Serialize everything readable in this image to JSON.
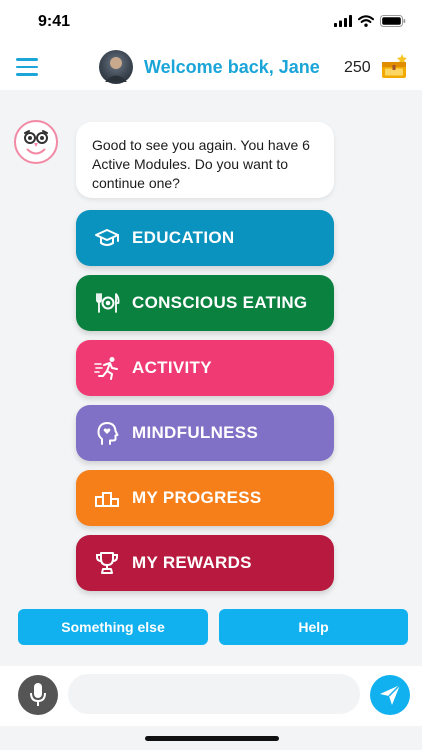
{
  "status_bar": {
    "time": "9:41"
  },
  "header": {
    "welcome": "Welcome back, Jane",
    "points": "250",
    "accent_color": "#1BA5D8",
    "icons": [
      "hamburger-menu-icon",
      "avatar",
      "treasure-chest-icon"
    ]
  },
  "chat": {
    "message": "Good to see you again. You have 6 Active Modules. Do you want to continue one?"
  },
  "modules": [
    {
      "label": "EDUCATION",
      "color": "#0A93BE",
      "icon": "graduation-cap-icon"
    },
    {
      "label": "CONSCIOUS EATING",
      "color": "#0B8140",
      "icon": "plate-cutlery-icon"
    },
    {
      "label": "ACTIVITY",
      "color": "#EF3A73",
      "icon": "running-person-icon"
    },
    {
      "label": "MINDFULNESS",
      "color": "#8070C6",
      "icon": "head-heart-icon"
    },
    {
      "label": "MY PROGRESS",
      "color": "#F77F1A",
      "icon": "podium-icon"
    },
    {
      "label": "MY REWARDS",
      "color": "#B71A3E",
      "icon": "trophy-icon"
    }
  ],
  "quick_replies": {
    "something_else": "Something else",
    "help": "Help",
    "color": "#11B0EE"
  },
  "composer": {
    "value": "",
    "placeholder": "",
    "icons": [
      "microphone-icon",
      "send-paper-plane-icon"
    ]
  }
}
